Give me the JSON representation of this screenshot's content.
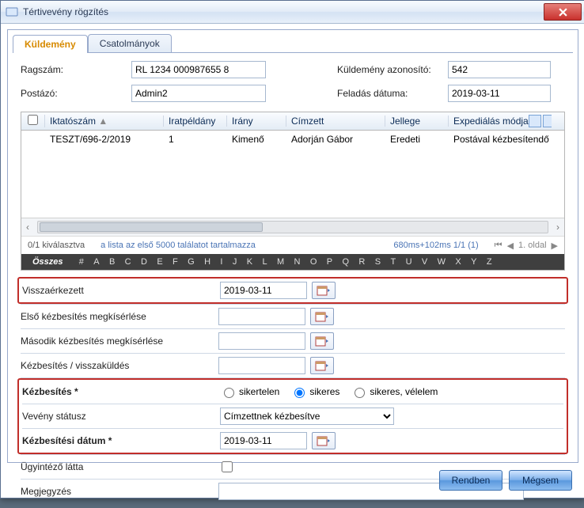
{
  "window": {
    "title": "Tértivevény rögzítés"
  },
  "tabs": {
    "t0": "Küldemény",
    "t1": "Csatolmányok"
  },
  "top": {
    "ragszam_label": "Ragszám:",
    "ragszam_value": "RL 1234 000987655 8",
    "postazo_label": "Postázó:",
    "postazo_value": "Admin2",
    "azon_label": "Küldemény azonosító:",
    "azon_value": "542",
    "feladas_label": "Feladás dátuma:",
    "feladas_value": "2019-03-11"
  },
  "table": {
    "headers": {
      "iktatoszam": "Iktatószám",
      "iratpeldany": "Iratpéldány",
      "irany": "Irány",
      "cimzett": "Címzett",
      "jellege": "Jellege",
      "exped": "Expediálás módja"
    },
    "rows": [
      {
        "iktatoszam": "TESZT/696-2/2019",
        "iratpeldany": "1",
        "irany": "Kimenő",
        "cimzett": "Adorján Gábor",
        "jellege": "Eredeti",
        "exped": "Postával kézbesítendő"
      }
    ],
    "status": {
      "selected": "0/1 kiválasztva",
      "limit_note": "a lista az első 5000 találatot tartalmazza",
      "timing": "680ms+102ms 1/1 (1)",
      "page": "1. oldal"
    },
    "alpha_all": "Összes",
    "alpha": [
      "#",
      "A",
      "B",
      "C",
      "D",
      "E",
      "F",
      "G",
      "H",
      "I",
      "J",
      "K",
      "L",
      "M",
      "N",
      "O",
      "P",
      "Q",
      "R",
      "S",
      "T",
      "U",
      "V",
      "W",
      "X",
      "Y",
      "Z"
    ]
  },
  "form": {
    "visszaerkezett_label": "Visszaérkezett",
    "visszaerkezett_value": "2019-03-11",
    "elso_label": "Első kézbesítés megkísérlése",
    "elso_value": "",
    "masodik_label": "Második kézbesítés megkísérlése",
    "masodik_value": "",
    "vissza_label": "Kézbesítés / visszaküldés",
    "vissza_value": "",
    "kezbesites_label": "Kézbesítés *",
    "radio_sikertelen": "sikertelen",
    "radio_sikeres": "sikeres",
    "radio_velelem": "sikeres, vélelem",
    "veveny_label": "Vevény státusz",
    "veveny_value": "Címzettnek kézbesítve",
    "kdatum_label": "Kézbesítési dátum *",
    "kdatum_value": "2019-03-11",
    "ugy_label": "Ügyintéző látta",
    "megj_label": "Megjegyzés"
  },
  "buttons": {
    "ok": "Rendben",
    "cancel": "Mégsem"
  }
}
